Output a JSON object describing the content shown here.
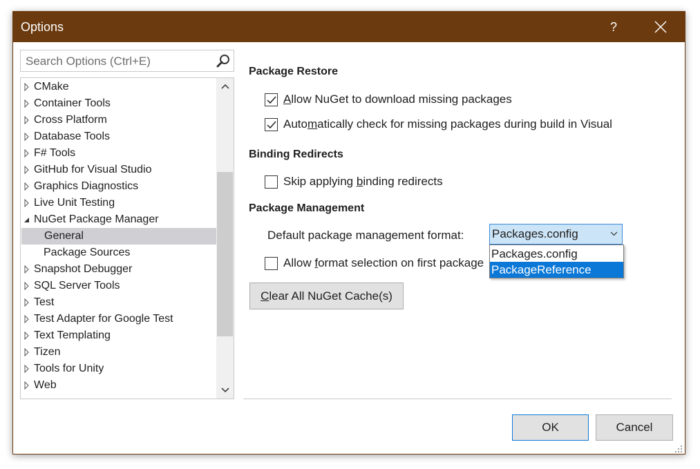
{
  "window": {
    "title": "Options",
    "help_label": "?"
  },
  "search": {
    "placeholder": "Search Options (Ctrl+E)"
  },
  "tree": {
    "items": [
      {
        "label": "CMake",
        "expanded": false
      },
      {
        "label": "Container Tools",
        "expanded": false
      },
      {
        "label": "Cross Platform",
        "expanded": false
      },
      {
        "label": "Database Tools",
        "expanded": false
      },
      {
        "label": "F# Tools",
        "expanded": false
      },
      {
        "label": "GitHub for Visual Studio",
        "expanded": false
      },
      {
        "label": "Graphics Diagnostics",
        "expanded": false
      },
      {
        "label": "Live Unit Testing",
        "expanded": false
      },
      {
        "label": "NuGet Package Manager",
        "expanded": true
      },
      {
        "label": "General",
        "child": true,
        "selected": true
      },
      {
        "label": "Package Sources",
        "child": true
      },
      {
        "label": "Snapshot Debugger",
        "expanded": false
      },
      {
        "label": "SQL Server Tools",
        "expanded": false
      },
      {
        "label": "Test",
        "expanded": false
      },
      {
        "label": "Test Adapter for Google Test",
        "expanded": false
      },
      {
        "label": "Text Templating",
        "expanded": false
      },
      {
        "label": "Tizen",
        "expanded": false
      },
      {
        "label": "Tools for Unity",
        "expanded": false
      },
      {
        "label": "Web",
        "expanded": false
      }
    ]
  },
  "package_restore": {
    "title": "Package Restore",
    "allow_download": {
      "pre": "",
      "key": "A",
      "post": "llow NuGet to download missing packages",
      "checked": true
    },
    "auto_check": {
      "pre": "Auto",
      "key": "m",
      "post": "atically check for missing packages during build in Visual",
      "checked": true
    }
  },
  "binding_redirects": {
    "title": "Binding Redirects",
    "skip": {
      "pre": "Skip applying ",
      "key": "b",
      "post": "inding redirects",
      "checked": false
    }
  },
  "package_management": {
    "title": "Package Management",
    "format_label": "Default package management format:",
    "selected_value": "Packages.config",
    "options": [
      "Packages.config",
      "PackageReference"
    ],
    "highlighted_option": "PackageReference",
    "allow_format": {
      "pre": "Allow ",
      "key": "f",
      "post": "ormat selection on first package",
      "checked": false
    }
  },
  "buttons": {
    "clear_cache": {
      "key": "C",
      "post": "lear All NuGet Cache(s)"
    },
    "ok": "OK",
    "cancel": "Cancel"
  },
  "colors": {
    "titlebar": "#6b3a0e",
    "accent": "#0b78d7",
    "combo_bg": "#cce4f7"
  }
}
